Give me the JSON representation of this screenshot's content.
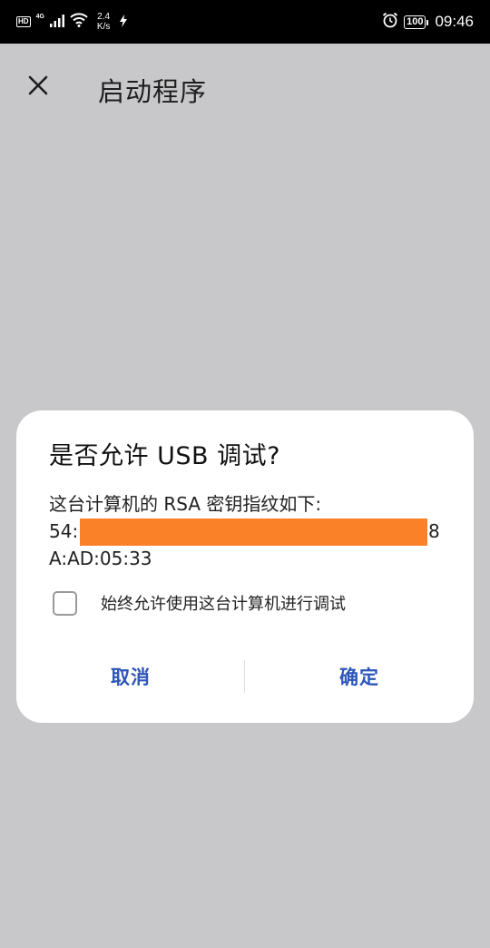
{
  "status_bar": {
    "hd": "HD",
    "network_type": "4G",
    "speed_value": "2.4",
    "speed_unit": "K/s",
    "battery": "100",
    "time": "09:46"
  },
  "app_bar": {
    "title": "启动程序",
    "close_icon": "close-icon"
  },
  "dialog": {
    "title": "是否允许 USB 调试?",
    "body_line1": "这台计算机的 RSA 密钥指纹如下:",
    "fingerprint_prefix": "54:",
    "fingerprint_suffix": "8",
    "fingerprint_line3": "A:AD:05:33",
    "checkbox_label": "始终允许使用这台计算机进行调试",
    "checkbox_checked": false,
    "cancel_label": "取消",
    "confirm_label": "确定",
    "accent_color": "#2d56b8",
    "redaction_color": "#fb8128"
  }
}
